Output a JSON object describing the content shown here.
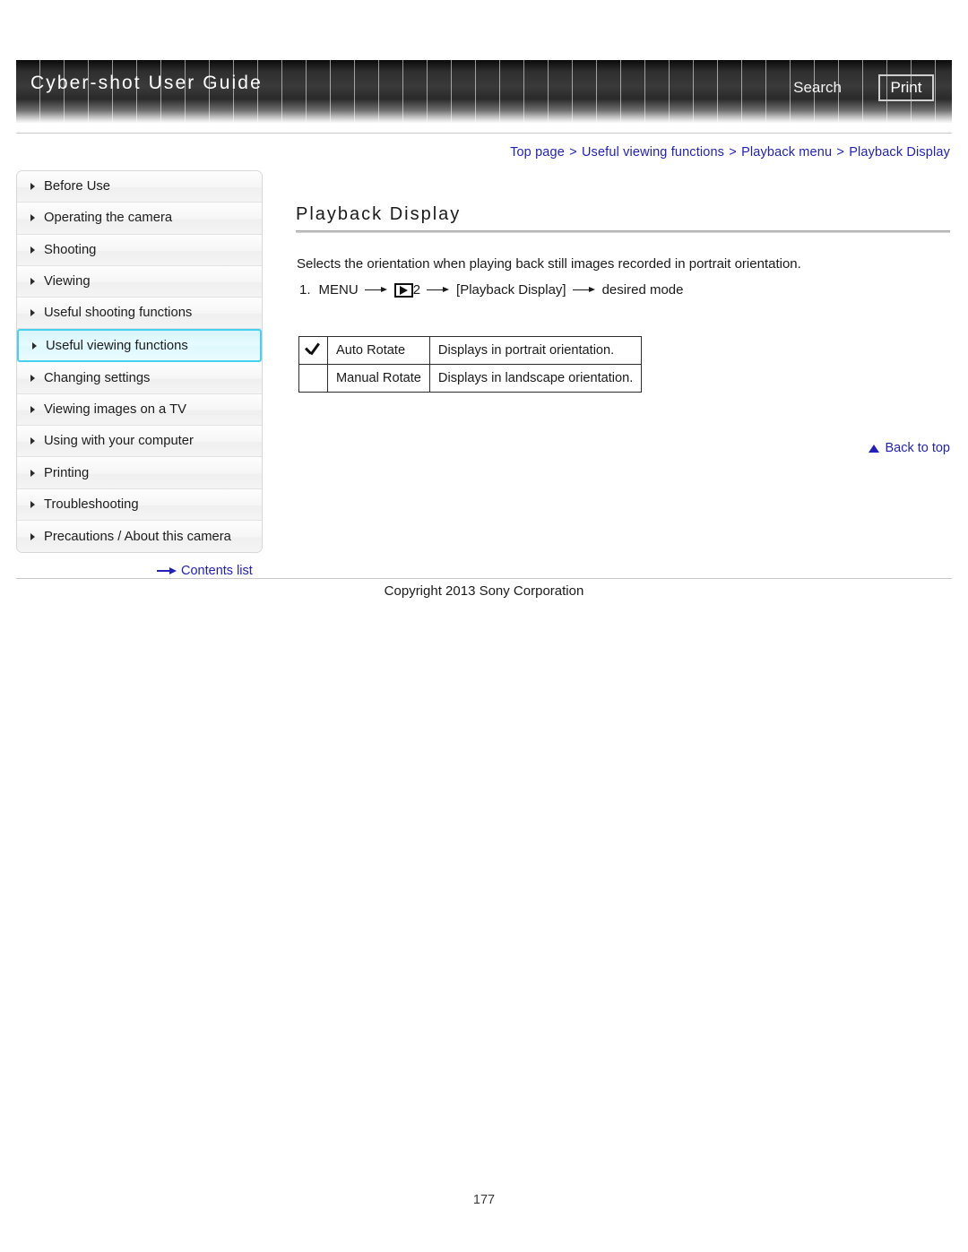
{
  "header": {
    "title": "Cyber-shot User Guide",
    "search_label": "Search",
    "print_label": "Print"
  },
  "breadcrumb": {
    "items": [
      "Top page",
      "Useful viewing functions",
      "Playback menu",
      "Playback Display"
    ],
    "separator": ">"
  },
  "sidebar": {
    "items": [
      {
        "label": "Before Use",
        "active": false
      },
      {
        "label": "Operating the camera",
        "active": false
      },
      {
        "label": "Shooting",
        "active": false
      },
      {
        "label": "Viewing",
        "active": false
      },
      {
        "label": "Useful shooting functions",
        "active": false
      },
      {
        "label": "Useful viewing functions",
        "active": true
      },
      {
        "label": "Changing settings",
        "active": false
      },
      {
        "label": "Viewing images on a TV",
        "active": false
      },
      {
        "label": "Using with your computer",
        "active": false
      },
      {
        "label": "Printing",
        "active": false
      },
      {
        "label": "Troubleshooting",
        "active": false
      },
      {
        "label": "Precautions / About this camera",
        "active": false
      }
    ],
    "contents_list_label": "Contents list"
  },
  "main": {
    "title": "Playback Display",
    "intro": "Selects the orientation when playing back still images recorded in portrait orientation.",
    "step": {
      "number": "1.",
      "menu_label": "MENU",
      "icon_name": "playback-mode-icon",
      "tab_number": "2",
      "setting_label": "[Playback Display]",
      "result_label": "desired mode"
    },
    "options_table": {
      "rows": [
        {
          "selected": true,
          "name": "Auto Rotate",
          "description": "Displays in portrait orientation."
        },
        {
          "selected": false,
          "name": "Manual Rotate",
          "description": "Displays in landscape orientation."
        }
      ]
    },
    "back_to_top_label": "Back to top"
  },
  "footer": {
    "copyright": "Copyright 2013 Sony Corporation",
    "page_number": "177"
  },
  "colors": {
    "link": "#2222bb",
    "active_border": "#46d2ee",
    "active_bg": "#e7fbfe"
  }
}
